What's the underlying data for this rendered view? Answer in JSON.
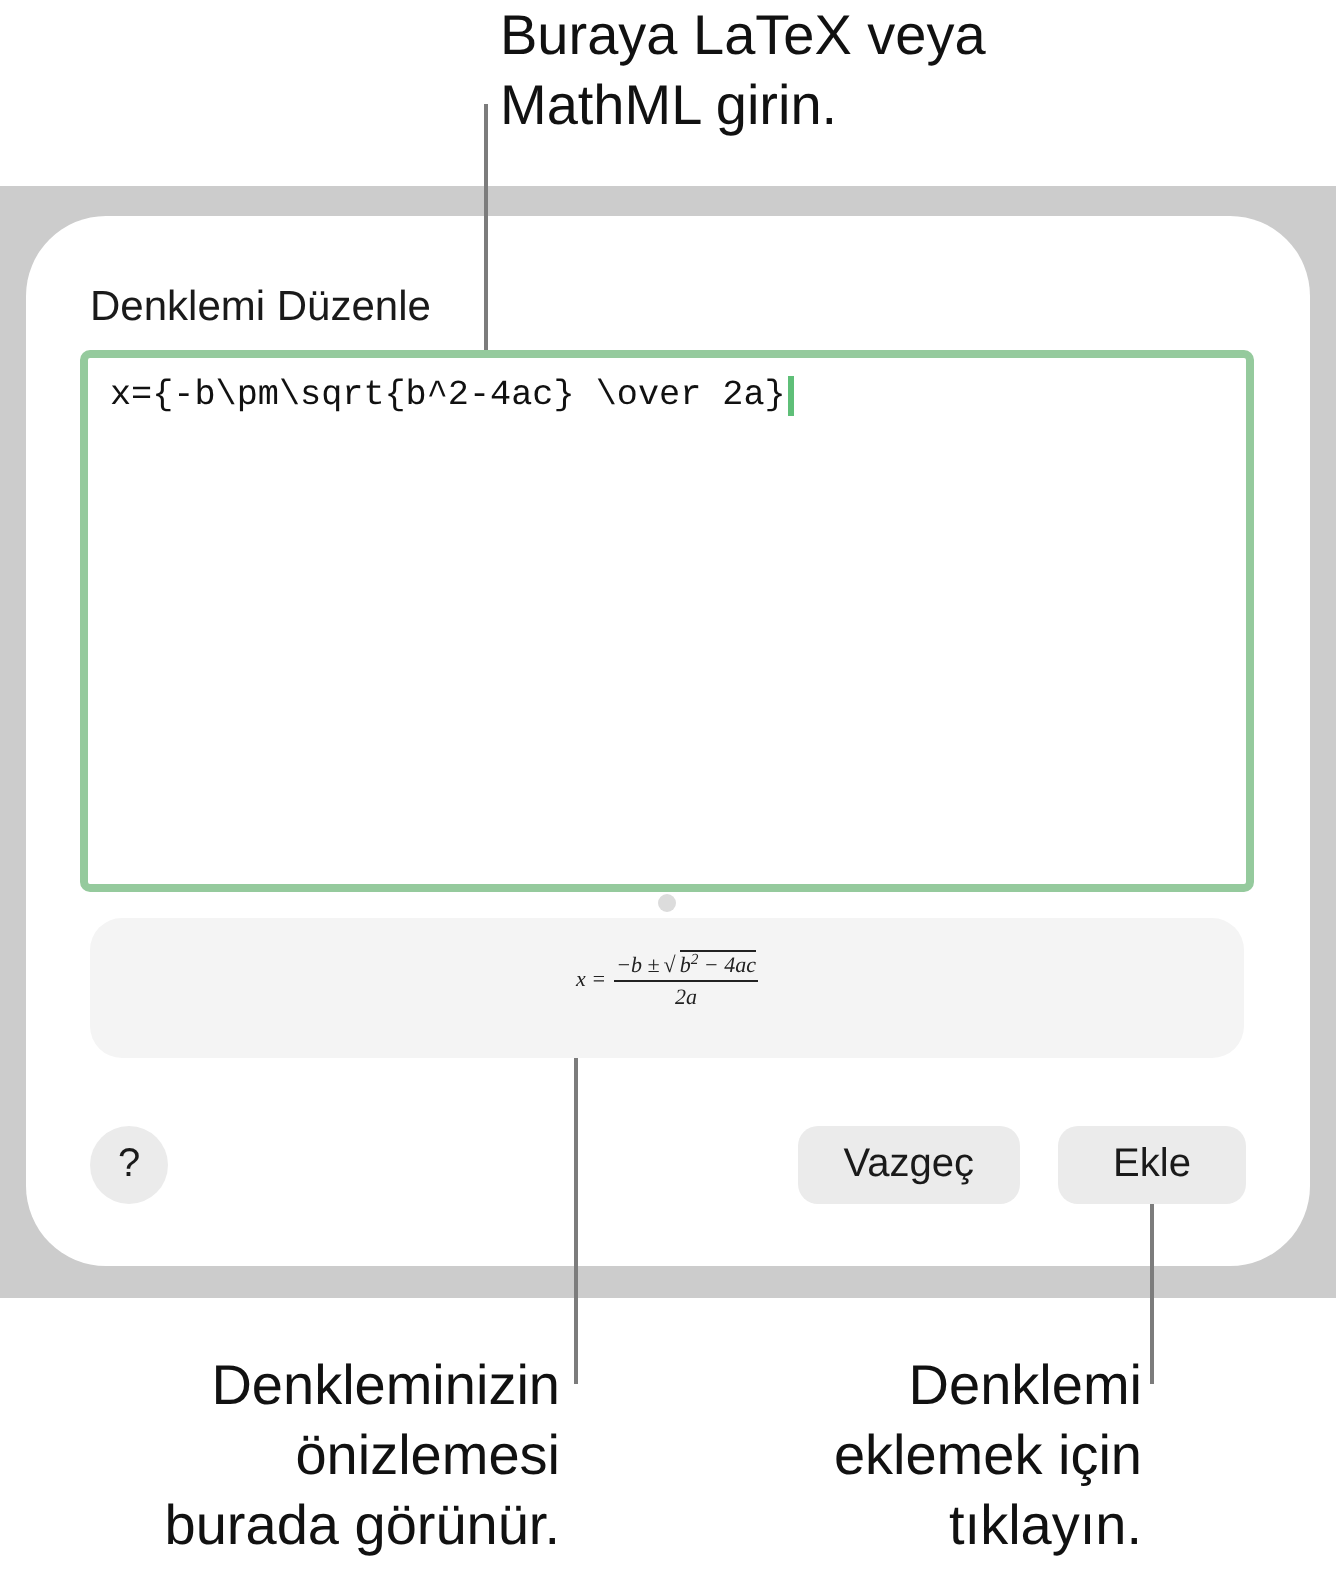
{
  "top_callout": {
    "lines": [
      "Buraya LaTeX veya",
      "MathML girin."
    ]
  },
  "dialog": {
    "title": "Denklemi Düzenle",
    "editor": {
      "value": "x={-b\\pm\\sqrt{b^2-4ac} \\over 2a}",
      "focused": true
    },
    "preview": {
      "lhs": "x =",
      "numerator": "−b ±",
      "radical": "√",
      "radicand": "b$^{2}$ − 4ac",
      "denominator": "2a"
    },
    "help_button": {
      "label": "?"
    },
    "buttons": [
      {
        "label": "Vazgeç"
      },
      {
        "label": "Ekle"
      }
    ]
  },
  "bottom_callouts": [
    {
      "lines": [
        "Denkleminizin",
        "önizlemesi",
        "burada görünür."
      ]
    },
    {
      "lines": [
        "Denklemi",
        "eklemek için",
        "tıklayın."
      ]
    }
  ]
}
